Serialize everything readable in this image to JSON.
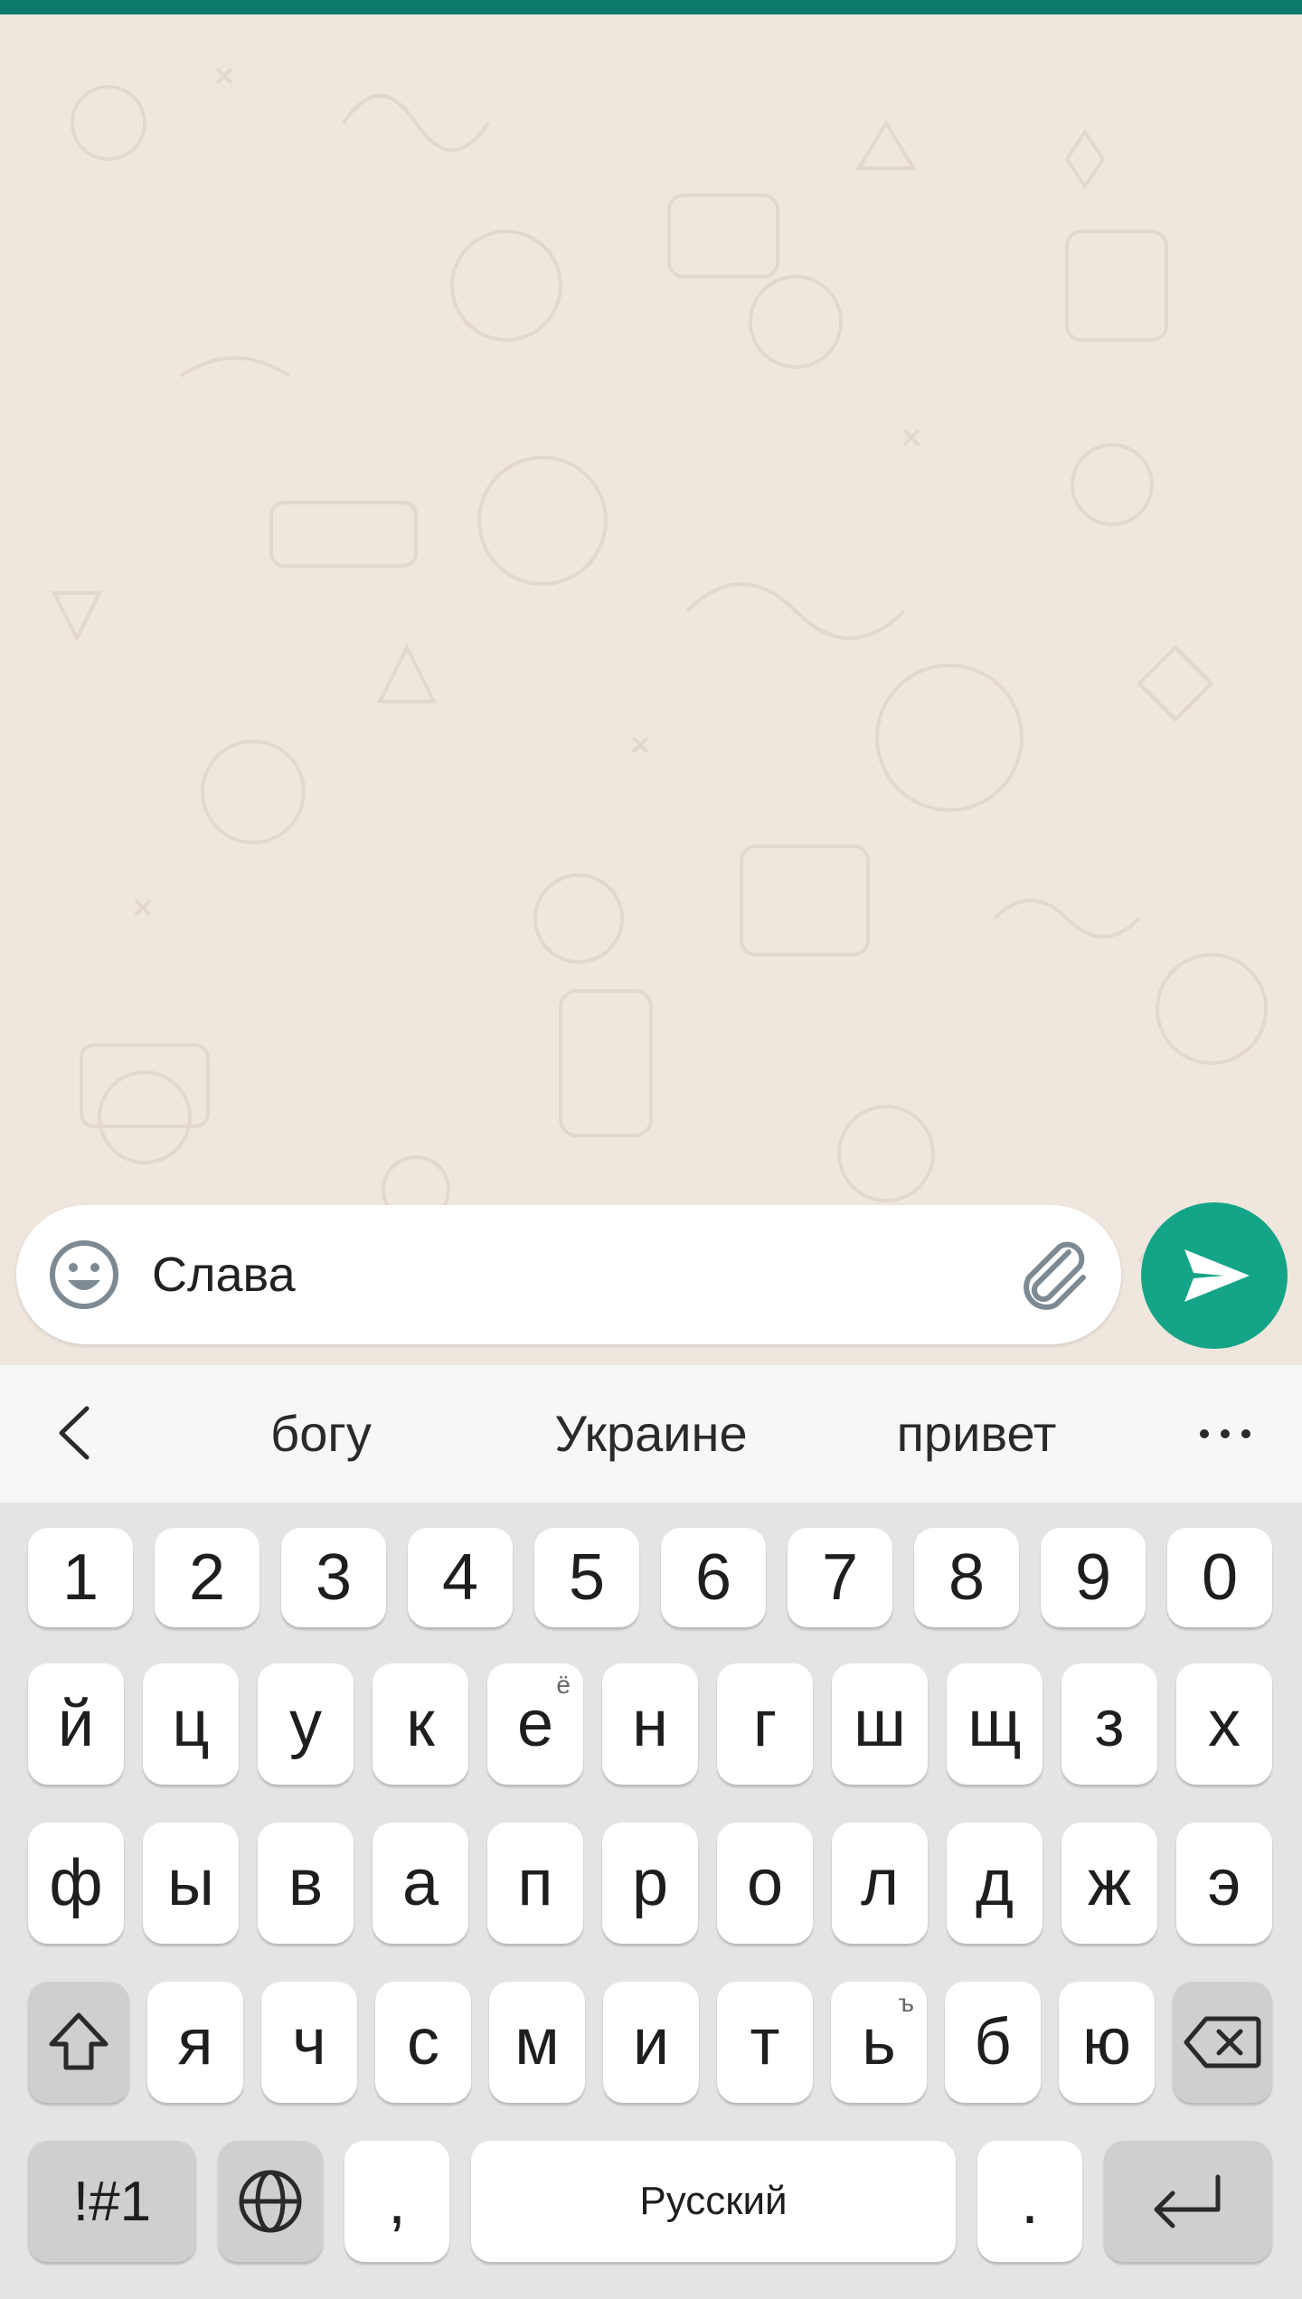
{
  "composer": {
    "message_text": "Слава",
    "emoji_icon": "smiley-face-icon",
    "attach_icon": "paperclip-icon",
    "send_icon": "send-arrow-icon"
  },
  "suggestions": {
    "words": [
      "богу",
      "Украине",
      "привет"
    ],
    "back_icon": "chevron-left-icon",
    "more_icon": "ellipsis-icon"
  },
  "keyboard": {
    "row_numbers": [
      "1",
      "2",
      "3",
      "4",
      "5",
      "6",
      "7",
      "8",
      "9",
      "0"
    ],
    "row1": [
      "й",
      "ц",
      "у",
      "к",
      "е",
      "н",
      "г",
      "ш",
      "щ",
      "з",
      "х"
    ],
    "row1_hint_e": "ё",
    "row2": [
      "ф",
      "ы",
      "в",
      "а",
      "п",
      "р",
      "о",
      "л",
      "д",
      "ж",
      "э"
    ],
    "row3": [
      "я",
      "ч",
      "с",
      "м",
      "и",
      "т",
      "ь",
      "б",
      "ю"
    ],
    "row3_hint_soft": "ъ",
    "symbols_label": "!#1",
    "comma_label": ",",
    "space_label": "Русский",
    "period_label": ".",
    "shift_icon": "shift-arrow-icon",
    "backspace_icon": "backspace-icon",
    "language_icon": "globe-icon",
    "enter_icon": "enter-return-icon"
  },
  "colors": {
    "header": "#0b7a6a",
    "chat_background": "#efe7de",
    "send_button": "#14a487",
    "keyboard_background": "#e4e4e4"
  }
}
